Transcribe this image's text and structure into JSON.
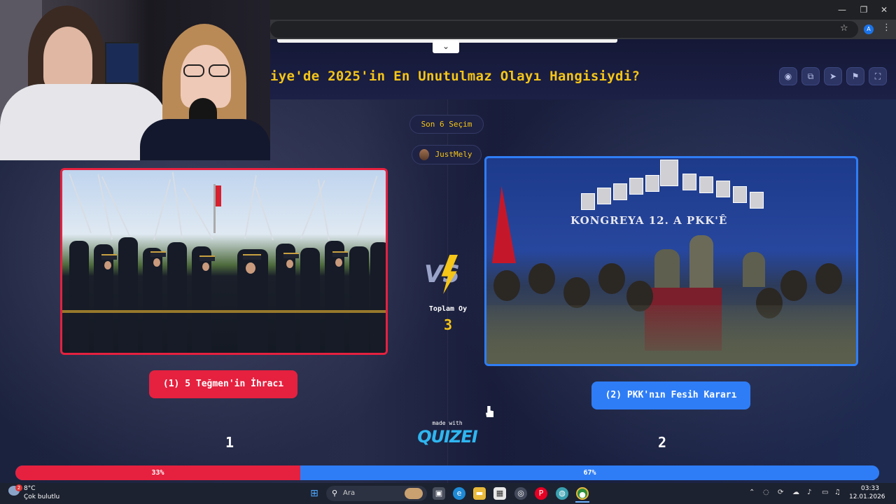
{
  "browser": {
    "window_controls": {
      "minimize": "—",
      "restore": "❐",
      "close": "✕"
    },
    "bookmark_icon": "star-icon",
    "profile_initial": "A",
    "menu_icon": "kebab-icon"
  },
  "quiz": {
    "title": "iye'de 2025'in En Unutulmaz Olayı Hangisiydi?",
    "round_label": "Son 6 Seçim",
    "player_name": "JustMely",
    "header_icons": [
      "eye-icon",
      "share-icon",
      "send-icon",
      "flag-icon",
      "fullscreen-icon"
    ],
    "total_votes_label": "Toplam Oy",
    "total_votes": "3",
    "vs_text": "VS",
    "made_with": "made with",
    "brand": "QUIZEI"
  },
  "choices": [
    {
      "label": "(1) 5 Teğmen'in İhracı",
      "votes": "1",
      "percent_label": "33%",
      "percent": 33,
      "color": "#e5213f"
    },
    {
      "label": "(2) PKK'nın Fesih Kararı",
      "votes": "2",
      "percent_label": "67%",
      "percent": 67,
      "color": "#2f7df6",
      "photo_banner": "KONGREYA 12. A PKK'Ê"
    }
  ],
  "taskbar": {
    "weather_temp": "8°C",
    "weather_desc": "Çok bulutlu",
    "weather_badge": "2",
    "search_placeholder": "Ara",
    "time": "03:33",
    "date": "12.01.2026",
    "apps": [
      "windows-start-icon",
      "task-view-icon",
      "edge-icon",
      "file-explorer-icon",
      "store-icon",
      "app-icon",
      "pinterest-icon",
      "globe-icon",
      "chrome-icon"
    ]
  },
  "colors": {
    "accent_yellow": "#f5c518",
    "red": "#e5213f",
    "blue": "#2f7df6",
    "brand_cyan": "#2fb6f0"
  }
}
